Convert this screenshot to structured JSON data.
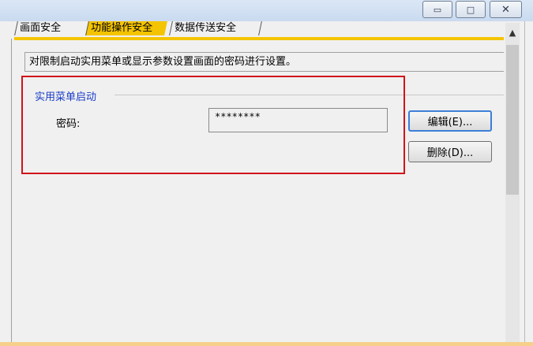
{
  "window": {
    "minimize": "▭",
    "maximize": "□",
    "close": "✕"
  },
  "tabs": [
    {
      "label": "画面安全"
    },
    {
      "label": "功能操作安全"
    },
    {
      "label": "数据传送安全"
    }
  ],
  "description": "对限制启动实用菜单或显示参数设置画面的密码进行设置。",
  "group": {
    "title": "实用菜单启动",
    "password_label": "密码:",
    "password_value": "********"
  },
  "buttons": {
    "edit": "编辑(E)...",
    "delete": "删除(D)..."
  },
  "colors": {
    "active_tab": "#f5c400",
    "group_title": "#1a3cc8",
    "highlight": "#d0141a"
  }
}
